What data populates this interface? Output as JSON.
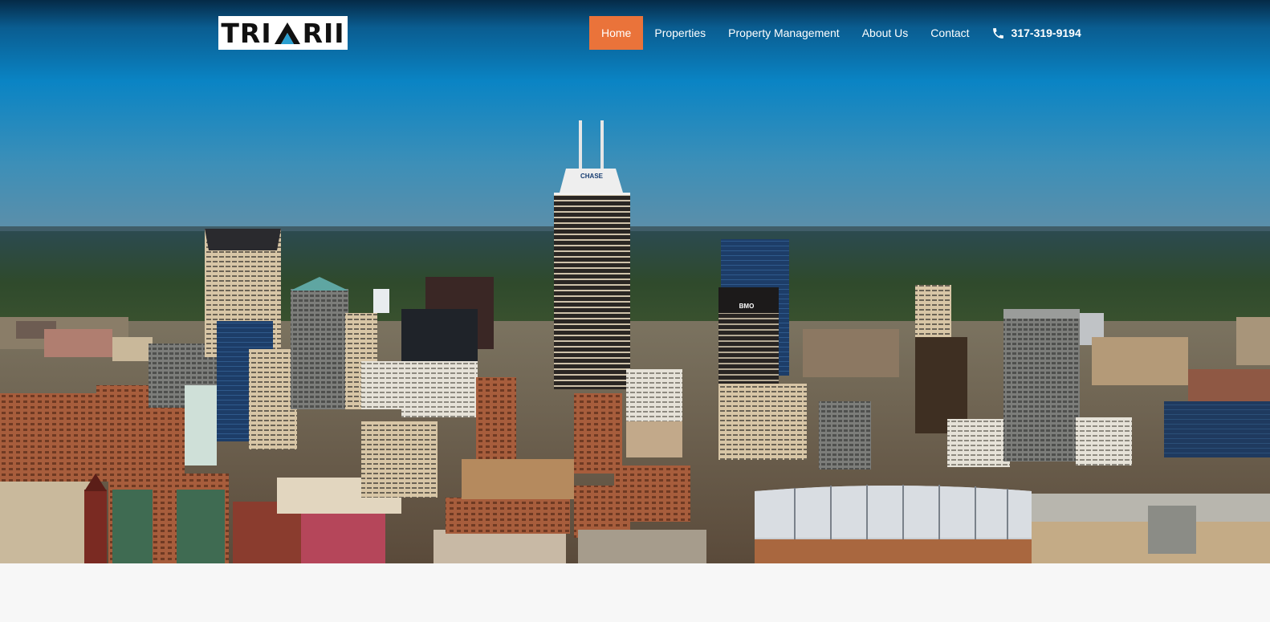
{
  "brand": {
    "logo_left": "TRI",
    "logo_right": "RII",
    "logo_accent_color": "#2a9fd0"
  },
  "nav": {
    "items": [
      {
        "label": "Home",
        "active": true
      },
      {
        "label": "Properties",
        "active": false
      },
      {
        "label": "Property Management",
        "active": false
      },
      {
        "label": "About Us",
        "active": false
      },
      {
        "label": "Contact",
        "active": false
      }
    ],
    "phone": "317-319-9194",
    "active_color": "#ea733a"
  },
  "hero": {
    "image": "city-skyline-photo",
    "tower_sign": "CHASE",
    "bank_sign": "BMO"
  }
}
